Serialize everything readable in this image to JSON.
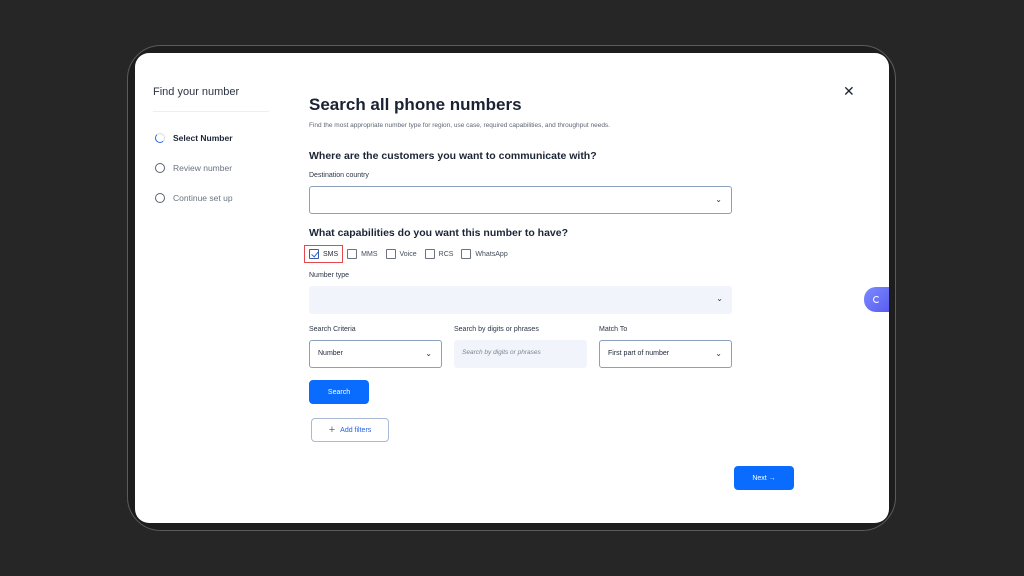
{
  "sidebar": {
    "title": "Find your number",
    "steps": [
      {
        "label": "Select Number",
        "active": true
      },
      {
        "label": "Review number",
        "active": false
      },
      {
        "label": "Continue set up",
        "active": false
      }
    ]
  },
  "close_glyph": "✕",
  "main": {
    "title": "Search all phone numbers",
    "subtitle": "Find the most appropriate number type for region, use case, required capabilities, and throughput needs.",
    "q_customers": "Where are the customers you want to communicate with?",
    "destination_label": "Destination country",
    "destination_value": "",
    "q_capabilities": "What capabilities do you want this number to have?",
    "capabilities": [
      {
        "label": "SMS",
        "checked": true
      },
      {
        "label": "MMS",
        "checked": false
      },
      {
        "label": "Voice",
        "checked": false
      },
      {
        "label": "RCS",
        "checked": false
      },
      {
        "label": "WhatsApp",
        "checked": false
      }
    ],
    "number_type_label": "Number type",
    "number_type_value": "",
    "search_criteria_label": "Search Criteria",
    "search_criteria_value": "Number",
    "digits_label": "Search by digits or phrases",
    "digits_placeholder": "Search by digits or phrases",
    "match_label": "Match To",
    "match_value": "First part of number",
    "search_button": "Search",
    "add_filters_button": "Add filters",
    "next_button": "Next →"
  },
  "colors": {
    "primary": "#0a6cff",
    "highlight": "#e5484d",
    "field_fill": "#f1f4fb"
  }
}
